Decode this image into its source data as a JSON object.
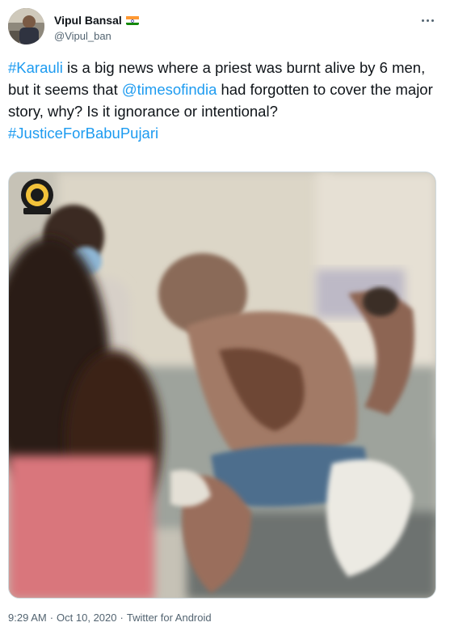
{
  "author": {
    "display_name": "Vipul Bansal",
    "handle": "@Vipul_ban",
    "flag_icon": "india-flag-icon"
  },
  "menu": {
    "icon": "more-options-icon"
  },
  "tweet": {
    "parts": [
      {
        "text": "#Karauli",
        "link": true
      },
      {
        "text": " is a big news where a priest was burnt alive by 6 men, but it seems that ",
        "link": false
      },
      {
        "text": "@timesofindia",
        "link": true
      },
      {
        "text": " had forgotten to cover the major story, why? Is it ignorance or intentional?",
        "link": false
      }
    ],
    "hashtag_line": "#JusticeForBabuPujari"
  },
  "media": {
    "type": "video-still"
  },
  "meta": {
    "time": "9:29 AM",
    "separator": "·",
    "date": "Oct 10, 2020",
    "source": "Twitter for Android"
  },
  "colors": {
    "link": "#1d9bf0",
    "secondary_text": "#536471",
    "primary_text": "#0f1419",
    "border": "#cfd9de"
  }
}
